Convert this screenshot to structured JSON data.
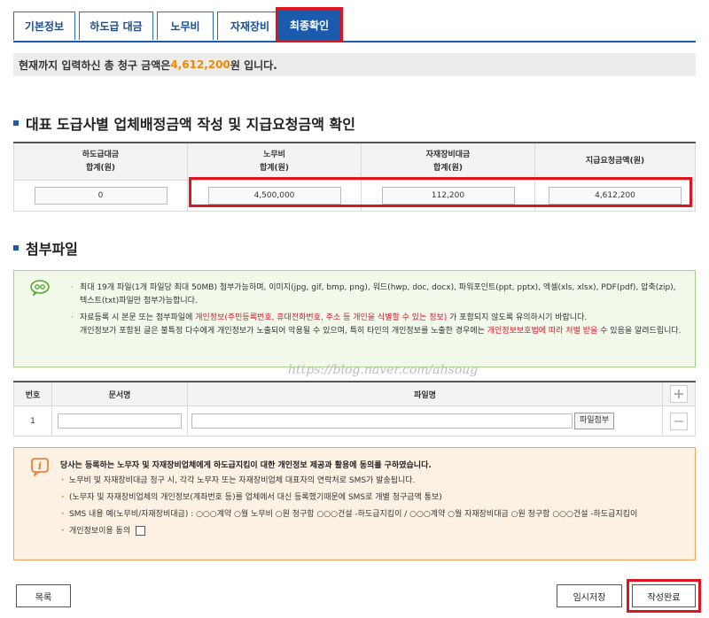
{
  "tabs": [
    {
      "label": "기본정보"
    },
    {
      "label": "하도급 대금"
    },
    {
      "label": "노무비"
    },
    {
      "label": "자재장비"
    },
    {
      "label": "최종확인",
      "active": true
    }
  ],
  "total": {
    "prefix": "현재까지 입력하신 총 청구 금액은 ",
    "amount": "4,612,200",
    "suffix": "원 입니다."
  },
  "section1": {
    "title": "대표 도급사별 업체배정금액 작성 및 지급요청금액 확인",
    "headers": [
      {
        "line1": "하도급대금",
        "line2": "합계(원)"
      },
      {
        "line1": "노무비",
        "line2": "합계(원)"
      },
      {
        "line1": "자재장비대금",
        "line2": "합계(원)"
      },
      {
        "line1": "지급요청금액(원)",
        "line2": ""
      }
    ],
    "values": [
      "0",
      "4,500,000",
      "112,200",
      "4,612,200"
    ]
  },
  "section2": {
    "title": "첨부파일",
    "notice": {
      "item1": "최대 19개 파일(1개 파일당 최대 50MB) 첨부가능하며, 이미지(jpg, gif, bmp, png), 워드(hwp, doc, docx), 파워포인트(ppt, pptx), 엑셀(xls, xlsx), PDF(pdf), 압축(zip), 텍스트(txt)파일만 첨부가능합니다.",
      "item2_a": "자료등록 시 본문 또는 첨부파일에 ",
      "item2_red": "개인정보(주민등록번호, 휴대전화번호, 주소 등 개인을 식별할 수 있는 정보)",
      "item2_b": " 가 포함되지 않도록 유의하시기 바랍니다.",
      "item2_c": "개인정보가 포함된 글은 불특정 다수에게 개인정보가 노출되어 악용될 수 있으며, 특히 타인의 개인정보를 노출한 경우에는 ",
      "item2_red2": "개인정보보호법에 따라 처벌 받을",
      "item2_d": " 수 있음을 알려드립니다."
    },
    "table": {
      "col_no": "번호",
      "col_doc": "문서명",
      "col_file": "파일명",
      "plus": "+",
      "minus": "−",
      "row_no": "1",
      "attach_button": "파일첨부"
    }
  },
  "watermark": "https://blog.naver.com/ahsoug",
  "consent": {
    "head": "당사는 등록하는 노무자 및 자재장비업체에게 하도급지킴이 대한 개인정보 제공과 활용에 동의를 구하였습니다.",
    "item1": "노무비 및 자재장비대금 청구 시, 각각 노무자 또는 자재장비업체 대표자의 연락처로 SMS가 발송됩니다.",
    "item2": "(노무자 및 자재장비업체의 개인정보(계좌번호 등)를 업체에서 대신 등록했기때문에 SMS로 개별 청구금액 통보)",
    "item3": "SMS 내용 예(노무비/자재장비대금) : ○○○계약 ○월 노무비 ○원 청구함 ○○○건설 -하도급지킴이 / ○○○계약 ○월 자재장비대금 ○원 청구함 ○○○건설 -하도급지킴이",
    "item4": "개인정보이용 동의"
  },
  "buttons": {
    "list": "목록",
    "temp_save": "임시저장",
    "complete": "작성완료"
  }
}
